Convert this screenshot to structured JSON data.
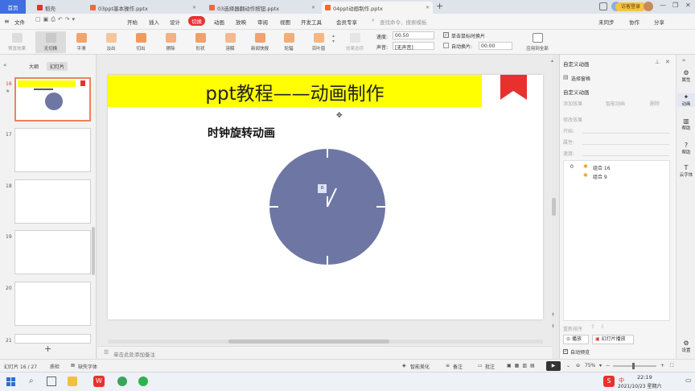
{
  "titlebar": {
    "tabs": [
      {
        "label": "首页",
        "active": true
      },
      {
        "label": "稻壳"
      },
      {
        "label": "03ppt基本操作.pptx"
      },
      {
        "label": "03选择器翻动作按钮.pptx"
      },
      {
        "label": "04ppt动画制作.pptx"
      }
    ],
    "add_tab": "+",
    "user_badge": "访客登录"
  },
  "menubar": {
    "file": "文件",
    "items": [
      "开始",
      "插入",
      "设计",
      "切换",
      "动画",
      "放映",
      "审阅",
      "视图",
      "开发工具",
      "会员专享"
    ],
    "active": "切换",
    "search_placeholder": "查找命令、搜索模板",
    "right": [
      "未同步",
      "协作",
      "分享"
    ]
  },
  "ribbon": {
    "preview": "预览效果",
    "effects": [
      "无切换",
      "平滑",
      "淡出",
      "切出",
      "擦除",
      "形状",
      "溶解",
      "新闻快报",
      "轮辐",
      "百叶窗"
    ],
    "effect_options": "效果选项",
    "speed_label": "速度:",
    "speed_value": "00.50",
    "sound_label": "声音:",
    "sound_value": "[无声音]",
    "on_click": "单击鼠标时换片",
    "auto_label": "自动换片:",
    "auto_value": "00:00",
    "apply_all": "应用到全部"
  },
  "leftpanel": {
    "tab_outline": "大纲",
    "tab_slides": "幻灯片",
    "slides": [
      "16",
      "17",
      "18",
      "19",
      "20",
      "21"
    ],
    "add": "+"
  },
  "slide": {
    "title": "ppt教程——动画制作",
    "subtitle": "时钟旋转动画",
    "clock_label": "0"
  },
  "notes_placeholder": "单击此处添加备注",
  "rightpane": {
    "title": "自定义动画",
    "select_pane": "选择窗格",
    "section": "自定义动画",
    "add_effect": "添加效果",
    "smart_anim": "智能动画",
    "delete": "删除",
    "modify": "修改效果",
    "start": "开始:",
    "property": "属性:",
    "speed": "速度:",
    "items": [
      {
        "index": "0",
        "label": "组合 16"
      },
      {
        "index": "",
        "label": "组合 9"
      }
    ],
    "reorder": "重新排序",
    "play": "播放",
    "slideshow": "幻灯片播放",
    "auto_preview": "自动预览"
  },
  "sidebar": [
    "属性",
    "动画",
    "帮助",
    "帮助",
    "云字体"
  ],
  "sidebar_bottom": "设置",
  "statusbar": {
    "slide_info": "幻灯片 16 / 27",
    "theme": "质检",
    "missing_font": "缺失字体",
    "beautify": "智能美化",
    "notes": "备注",
    "comments": "批注",
    "zoom": "75%"
  },
  "taskbar": {
    "time": "22:19",
    "date": "2021/10/23 星期六",
    "ime": "中"
  },
  "colors": {
    "accent_red": "#e8312f",
    "title_band": "#ffff00",
    "clock_face": "#6e77a3"
  }
}
